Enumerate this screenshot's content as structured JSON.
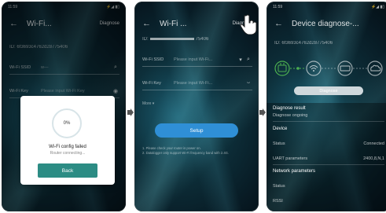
{
  "screens": [
    {
      "status_time": "11:59",
      "status_icons": "⚡◢ ▮▯",
      "title": "Wi-Fi...",
      "action": "Diagnose",
      "id_text": "ID: 6f3693c4762d28775406",
      "ssid_label": "Wi-Fi SSID",
      "ssid_value": "w—",
      "key_label": "Wi-Fi Key",
      "key_placeholder": "Please input Wi-Fi Key",
      "dialog": {
        "progress": "0%",
        "title": "Wi-Fi config failed",
        "subtitle": "Router connecting...",
        "button": "Back"
      }
    },
    {
      "title": "Wi-Fi ...",
      "action": "Diagnose",
      "id_prefix": "ID:",
      "id_suffix": "75406",
      "ssid_label": "Wi-Fi SSID",
      "ssid_placeholder": "Please input Wi-Fi...",
      "key_label": "Wi-Fi Key",
      "key_placeholder": "Please input Wi-Fi...",
      "more": "More ▾",
      "button": "Setup",
      "notes": [
        "1. Please check your router is power on.",
        "2. Datalogger only support Wi-Fi frequency band with 2.4G."
      ]
    },
    {
      "status_time": "11:59",
      "status_icons": "⚡◢ ▮▯",
      "title": "Device diagnose-...",
      "id_text": "ID: 6f3693c4762d28775406",
      "diagnose_button": "Diagnose",
      "result_header": "Diagnose result",
      "result_value": "Diagnose ongoing",
      "device_header": "Device",
      "status_label": "Status",
      "status_value": "Connected",
      "uart_label": "UART parameters",
      "uart_value": "2400,8,N,1",
      "network_header": "Network parameters",
      "net_status_label": "Status",
      "rssi_label": "RSSI",
      "accent": "#4caf50"
    }
  ]
}
